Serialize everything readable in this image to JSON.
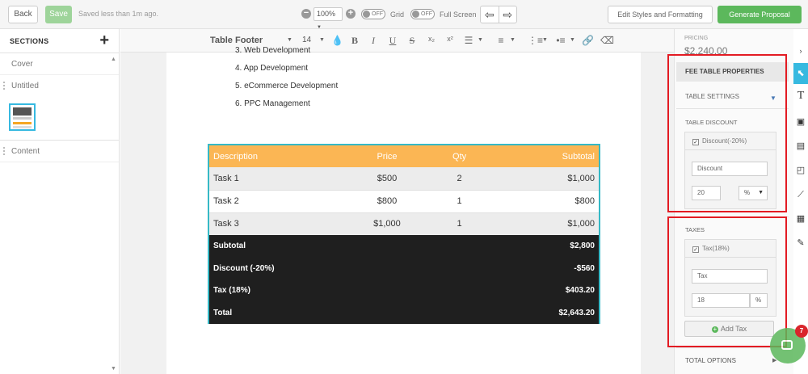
{
  "topbar": {
    "back_label": "Back",
    "save_label": "Save",
    "saved_text": "Saved less than 1m ago.",
    "zoom_value": "100%",
    "grid_toggle": "OFF",
    "grid_label": "Grid",
    "fullscreen_toggle": "OFF",
    "fullscreen_label": "Full Screen",
    "edit_styles_label": "Edit Styles and Formatting",
    "generate_label": "Generate Proposal"
  },
  "sidebar": {
    "title": "SECTIONS",
    "add_symbol": "+",
    "items": [
      {
        "label": "Cover"
      },
      {
        "label": "Untitled"
      },
      {
        "label": "Content"
      }
    ]
  },
  "format_bar": {
    "style": "Table Footer",
    "font_size": "14",
    "bold": "B",
    "italic": "I",
    "underline": "U",
    "strike": "S",
    "subscript": "x₂",
    "superscript": "x²"
  },
  "page": {
    "list_items": [
      "3. Web Development",
      "4. App Development",
      "5. eCommerce Development",
      "6. PPC Management"
    ],
    "table": {
      "headers": [
        "Description",
        "Price",
        "Qty",
        "Subtotal"
      ],
      "rows": [
        [
          "Task 1",
          "$500",
          "2",
          "$1,000"
        ],
        [
          "Task 2",
          "$800",
          "1",
          "$800"
        ],
        [
          "Task 3",
          "$1,000",
          "1",
          "$1,000"
        ]
      ],
      "summary": [
        [
          "Subtotal",
          "$2,800"
        ],
        [
          "Discount (-20%)",
          "-$560"
        ],
        [
          "Tax (18%)",
          "$403.20"
        ],
        [
          "Total",
          "$2,643.20"
        ]
      ],
      "colors": {
        "header": "#fbb654",
        "summary": "#1f1f1f",
        "border": "#36b9c6"
      }
    }
  },
  "panel": {
    "pricing_label": "PRICING",
    "pricing_value": "$2,240.00",
    "header": "FEE TABLE PROPERTIES",
    "table_settings": "TABLE SETTINGS",
    "table_discount": "TABLE DISCOUNT",
    "discount_checkbox_label": "Discount(-20%)",
    "discount_name": "Discount",
    "discount_value": "20",
    "discount_unit": "%",
    "taxes": "TAXES",
    "tax_checkbox_label": "Tax(18%)",
    "tax_name": "Tax",
    "tax_value": "18",
    "tax_unit": "%",
    "add_tax_label": "Add Tax",
    "total_options": "TOTAL OPTIONS"
  },
  "chat": {
    "badge_count": "7"
  },
  "accent_colors": {
    "highlight": "#e31b23",
    "primary": "#36b9e0",
    "success": "#5cb85c"
  }
}
